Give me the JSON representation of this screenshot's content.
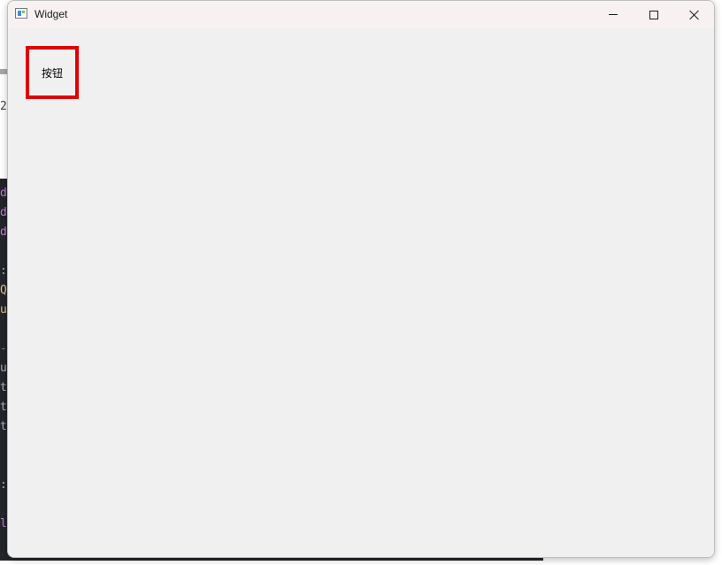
{
  "window": {
    "title": "Widget",
    "icon": "app-window-icon",
    "controls": {
      "minimize_icon": "minimize-icon",
      "maximize_icon": "maximize-icon",
      "close_icon": "close-icon"
    }
  },
  "content": {
    "button_label": "按钮",
    "button_border_color": "#e00000"
  },
  "background": {
    "light_text": "2",
    "editor_fragments": [
      {
        "text": "d",
        "color": "#c678dd"
      },
      {
        "text": "d",
        "color": "#c678dd"
      },
      {
        "text": "d",
        "color": "#c678dd"
      },
      {
        "text": "",
        "color": "#abb2bf"
      },
      {
        "text": ":",
        "color": "#abb2bf"
      },
      {
        "text": "Q",
        "color": "#e5c07b"
      },
      {
        "text": "u",
        "color": "#e5c07b"
      },
      {
        "text": "",
        "color": "#abb2bf"
      },
      {
        "text": "-",
        "color": "#7f848e"
      },
      {
        "text": "u",
        "color": "#abb2bf"
      },
      {
        "text": "t",
        "color": "#abb2bf"
      },
      {
        "text": "t",
        "color": "#abb2bf"
      },
      {
        "text": "t",
        "color": "#abb2bf"
      },
      {
        "text": "",
        "color": "#abb2bf"
      },
      {
        "text": "",
        "color": "#abb2bf"
      },
      {
        "text": ":",
        "color": "#abb2bf"
      },
      {
        "text": "",
        "color": "#abb2bf"
      },
      {
        "text": "l",
        "color": "#c678dd"
      }
    ]
  }
}
